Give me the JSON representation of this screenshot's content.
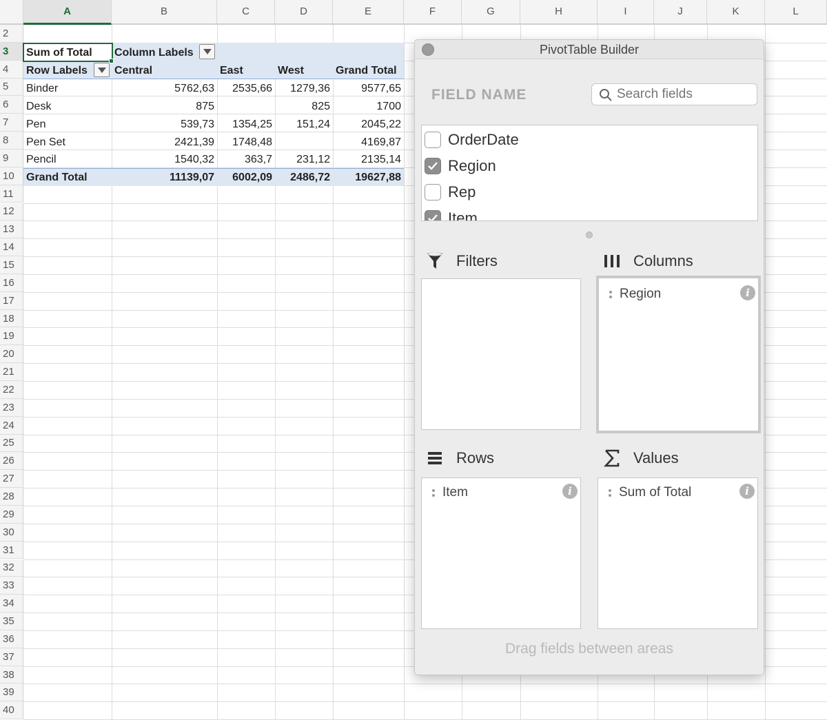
{
  "sheet": {
    "columns": [
      "A",
      "B",
      "C",
      "D",
      "E",
      "F",
      "G",
      "H",
      "I",
      "J",
      "K",
      "L"
    ],
    "selected_column": "A",
    "rows": [
      "2",
      "3",
      "4",
      "5",
      "6",
      "7",
      "8",
      "9",
      "10",
      "11",
      "12",
      "13",
      "14",
      "15",
      "16",
      "17",
      "18",
      "19",
      "20",
      "21",
      "22",
      "23",
      "24",
      "25",
      "26",
      "27",
      "28",
      "29",
      "30",
      "31",
      "32",
      "33",
      "34",
      "35",
      "36",
      "37",
      "38",
      "39",
      "40"
    ],
    "selected_row": "3"
  },
  "pivot": {
    "corner_label": "Sum of Total",
    "column_labels": "Column Labels",
    "row_labels": "Row Labels",
    "headers": [
      "Central",
      "East",
      "West",
      "Grand Total"
    ],
    "rows": [
      {
        "label": "Binder",
        "values": [
          "5762,63",
          "2535,66",
          "1279,36",
          "9577,65"
        ]
      },
      {
        "label": "Desk",
        "values": [
          "875",
          "",
          "825",
          "1700"
        ]
      },
      {
        "label": "Pen",
        "values": [
          "539,73",
          "1354,25",
          "151,24",
          "2045,22"
        ]
      },
      {
        "label": "Pen Set",
        "values": [
          "2421,39",
          "1748,48",
          "",
          "4169,87"
        ]
      },
      {
        "label": "Pencil",
        "values": [
          "1540,32",
          "363,7",
          "231,12",
          "2135,14"
        ]
      }
    ],
    "grand_total": {
      "label": "Grand Total",
      "values": [
        "11139,07",
        "6002,09",
        "2486,72",
        "19627,88"
      ]
    }
  },
  "builder": {
    "title": "PivotTable Builder",
    "field_name_label": "FIELD NAME",
    "search_placeholder": "Search fields",
    "fields": [
      {
        "label": "OrderDate",
        "checked": false
      },
      {
        "label": "Region",
        "checked": true
      },
      {
        "label": "Rep",
        "checked": false
      },
      {
        "label": "Item",
        "checked": true
      }
    ],
    "areas": {
      "filters": {
        "title": "Filters",
        "items": []
      },
      "columns": {
        "title": "Columns",
        "items": [
          "Region"
        ]
      },
      "rows": {
        "title": "Rows",
        "items": [
          "Item"
        ]
      },
      "values": {
        "title": "Values",
        "items": [
          "Sum of Total"
        ]
      }
    },
    "hint": "Drag fields between areas"
  },
  "colors": {
    "accent_green": "#1f6b3a",
    "pivot_band": "#dde7f3"
  }
}
